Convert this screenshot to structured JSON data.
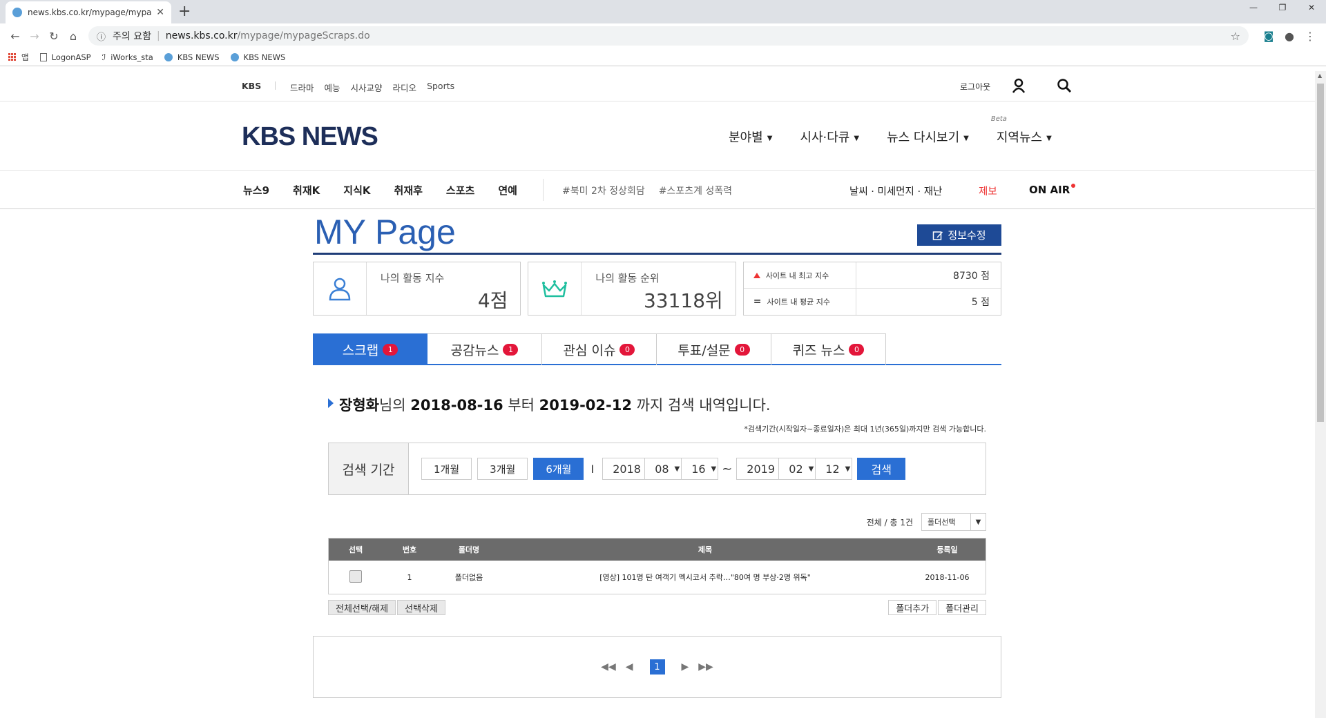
{
  "browser": {
    "tab_title": "news.kbs.co.kr/mypage/mypage",
    "url_warning": "주의 요함",
    "url_domain": "news.kbs.co.kr",
    "url_path": "/mypage/mypageScraps.do",
    "bookmarks": [
      "앱",
      "LogonASP",
      "iWorks_sta",
      "KBS NEWS",
      "KBS NEWS"
    ]
  },
  "topbar": {
    "brand": "KBS",
    "menu": [
      "드라마",
      "예능",
      "시사교양",
      "라디오",
      "Sports"
    ],
    "logout": "로그아웃"
  },
  "header": {
    "logo": "KBS NEWS",
    "gnb": [
      {
        "label": "분야별"
      },
      {
        "label": "시사·다큐"
      },
      {
        "label": "뉴스 다시보기"
      },
      {
        "label": "지역뉴스",
        "beta": "Beta"
      }
    ]
  },
  "subnav": {
    "items": [
      "뉴스9",
      "취재K",
      "지식K",
      "취재후",
      "스포츠",
      "연예"
    ],
    "tags": [
      "#북미 2차 정상회담",
      "#스포츠계 성폭력"
    ],
    "weather": "날씨 · 미세먼지 · 재난",
    "report": "제보",
    "onair": "ON AIR"
  },
  "mypage": {
    "title": "MY Page",
    "edit_button": "정보수정",
    "activity_label": "나의 활동 지수",
    "activity_value": "4점",
    "rank_label": "나의 활동 순위",
    "rank_value": "33118위",
    "site_max_label": "사이트 내 최고 지수",
    "site_max_value": "8730 점",
    "site_avg_label": "사이트 내 평균 지수",
    "site_avg_value": "5 점"
  },
  "tabs": [
    {
      "label": "스크랩",
      "count": "1"
    },
    {
      "label": "공감뉴스",
      "count": "1"
    },
    {
      "label": "관심 이슈",
      "count": "0"
    },
    {
      "label": "투표/설문",
      "count": "0"
    },
    {
      "label": "퀴즈 뉴스",
      "count": "0"
    }
  ],
  "search": {
    "user": "장형화",
    "suffix_name": "님의",
    "from": "2018-08-16",
    "from_suffix": "부터",
    "to": "2019-02-12",
    "to_suffix": "까지 검색 내역입니다.",
    "note": "*검색기간(시작일자~종료일자)은 최대 1년(365일)까지만 검색 가능합니다.",
    "period_label": "검색 기간",
    "period_buttons": [
      "1개월",
      "3개월",
      "6개월"
    ],
    "from_year": "2018",
    "from_month": "08",
    "from_day": "16",
    "to_year": "2019",
    "to_month": "02",
    "to_day": "12",
    "search_button": "검색"
  },
  "table": {
    "total_label": "전체 / 총",
    "total_count": "1건",
    "folder_select": "폴더선택",
    "headers": [
      "선택",
      "번호",
      "폴더명",
      "제목",
      "등록일"
    ],
    "rows": [
      {
        "no": "1",
        "folder": "폴더없음",
        "title": "[영상] 101명 탄 여객기 멕시코서 추락…\"80여 명 부상·2명 위독\"",
        "date": "2018-11-06"
      }
    ],
    "select_all": "전체선택/해제",
    "delete_selected": "선택삭제",
    "add_folder": "폴더추가",
    "manage_folder": "폴더관리"
  },
  "pager": {
    "current": "1"
  }
}
